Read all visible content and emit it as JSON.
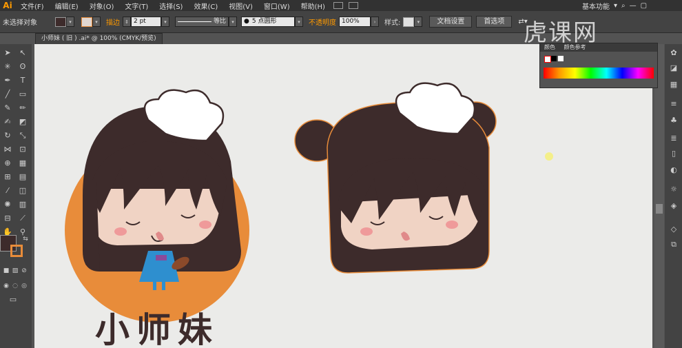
{
  "app": {
    "logo": "Ai"
  },
  "menu": [
    "文件(F)",
    "编辑(E)",
    "对象(O)",
    "文字(T)",
    "选择(S)",
    "效果(C)",
    "视图(V)",
    "窗口(W)",
    "帮助(H)"
  ],
  "workspace": {
    "label": "基本功能"
  },
  "control": {
    "selection": "未选择对象",
    "stroke_label": "描边",
    "stroke_value": "2 pt",
    "profile_label": "等比",
    "brush_label": "5 点圆形",
    "opacity_label": "不透明度",
    "opacity_value": "100%",
    "style_label": "样式:",
    "doc_setup": "文档设置",
    "prefs": "首选项"
  },
  "document": {
    "tab": "小师妹 ( 旧 ) .ai* @ 100% (CMYK/预览)"
  },
  "panel": {
    "color_title": "颜色",
    "guide_title": "颜色参考"
  },
  "artwork": {
    "logo_text": "小师妹"
  },
  "watermark": "虎课网",
  "colors": {
    "hair": "#3d2b2b",
    "skin": "#f0d3c4",
    "orange": "#e88c3a",
    "dress": "#2e8fcf",
    "blush": "#ef9a9a",
    "canvas": "#ebebe9"
  }
}
